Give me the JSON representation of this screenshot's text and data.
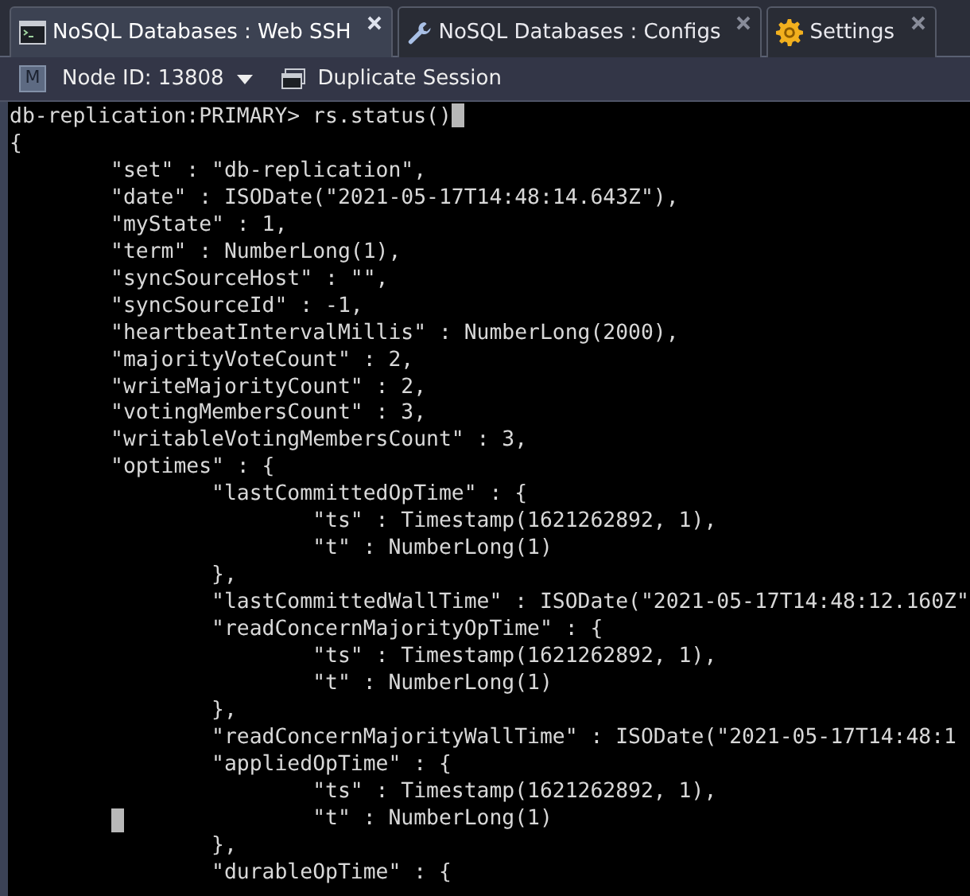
{
  "tabs": [
    {
      "label": "NoSQL Databases : Web SSH",
      "selected": true
    },
    {
      "label": "NoSQL Databases : Configs",
      "selected": false
    },
    {
      "label": "Settings",
      "selected": false
    }
  ],
  "toolbar": {
    "node_badge": "M",
    "node_label": "Node ID: 13808",
    "duplicate_label": "Duplicate Session"
  },
  "terminal": {
    "lines": [
      {
        "text": "db-replication:PRIMARY> rs.status()",
        "cursor": true
      },
      {
        "text": "{"
      },
      {
        "text": "\t\"set\" : \"db-replication\","
      },
      {
        "text": "\t\"date\" : ISODate(\"2021-05-17T14:48:14.643Z\"),"
      },
      {
        "text": "\t\"myState\" : 1,"
      },
      {
        "text": "\t\"term\" : NumberLong(1),"
      },
      {
        "text": "\t\"syncSourceHost\" : \"\","
      },
      {
        "text": "\t\"syncSourceId\" : -1,"
      },
      {
        "text": "\t\"heartbeatIntervalMillis\" : NumberLong(2000),"
      },
      {
        "text": "\t\"majorityVoteCount\" : 2,"
      },
      {
        "text": "\t\"writeMajorityCount\" : 2,"
      },
      {
        "text": "\t\"votingMembersCount\" : 3,"
      },
      {
        "text": "\t\"writableVotingMembersCount\" : 3,"
      },
      {
        "text": "\t\"optimes\" : {"
      },
      {
        "text": "\t\t\"lastCommittedOpTime\" : {"
      },
      {
        "text": "\t\t\t\"ts\" : Timestamp(1621262892, 1),"
      },
      {
        "text": "\t\t\t\"t\" : NumberLong(1)"
      },
      {
        "text": "\t\t},"
      },
      {
        "text": "\t\t\"lastCommittedWallTime\" : ISODate(\"2021-05-17T14:48:12.160Z\""
      },
      {
        "text": "\t\t\"readConcernMajorityOpTime\" : {"
      },
      {
        "text": "\t\t\t\"ts\" : Timestamp(1621262892, 1),"
      },
      {
        "text": "\t\t\t\"t\" : NumberLong(1)"
      },
      {
        "text": "\t\t},"
      },
      {
        "text": "\t\t\"readConcernMajorityWallTime\" : ISODate(\"2021-05-17T14:48:1"
      },
      {
        "text": "\t\t\"appliedOpTime\" : {"
      },
      {
        "text": "\t\t\t\"ts\" : Timestamp(1621262892, 1),"
      },
      {
        "text": "\t\t\t\"t\" : NumberLong(1)",
        "gutter_block": true
      },
      {
        "text": "\t\t},"
      },
      {
        "text": "\t\t\"durableOpTime\" : {"
      }
    ]
  }
}
